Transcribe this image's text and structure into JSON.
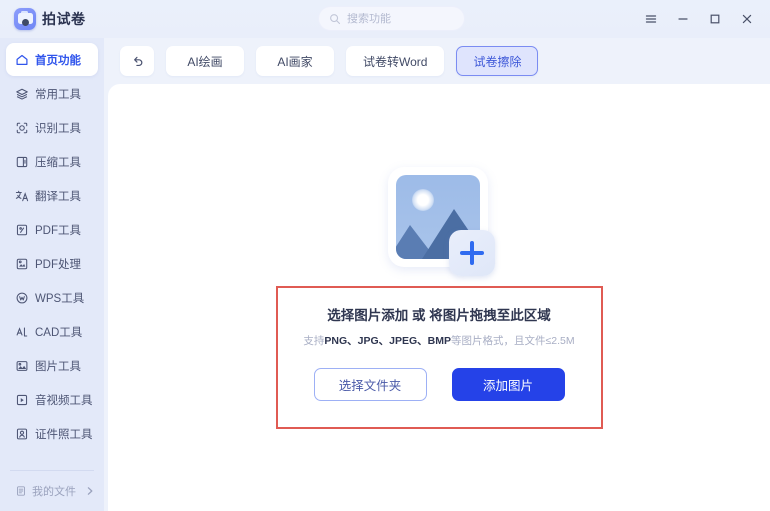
{
  "app": {
    "brand_name": "拍试卷",
    "logo_icon": "camera-app-icon"
  },
  "search": {
    "placeholder": "搜索功能",
    "value": "",
    "icon": "search-icon"
  },
  "window_controls": [
    {
      "name": "menu-button",
      "icon": "hamburger-menu-icon"
    },
    {
      "name": "minimize-button",
      "icon": "minimize-icon"
    },
    {
      "name": "maximize-button",
      "icon": "maximize-square-icon"
    },
    {
      "name": "close-button",
      "icon": "close-x-icon"
    }
  ],
  "sidebar": {
    "items": [
      {
        "label": "首页功能",
        "icon": "home-icon",
        "active": true
      },
      {
        "label": "常用工具",
        "icon": "layers-icon",
        "active": false
      },
      {
        "label": "识别工具",
        "icon": "scan-target-icon",
        "active": false
      },
      {
        "label": "压缩工具",
        "icon": "compress-icon",
        "active": false
      },
      {
        "label": "翻译工具",
        "icon": "translate-icon",
        "active": false
      },
      {
        "label": "PDF工具",
        "icon": "pdf-file-icon",
        "active": false
      },
      {
        "label": "PDF处理",
        "icon": "pdf-process-icon",
        "active": false
      },
      {
        "label": "WPS工具",
        "icon": "wps-circle-icon",
        "active": false
      },
      {
        "label": "CAD工具",
        "icon": "cad-ruler-icon",
        "active": false
      },
      {
        "label": "图片工具",
        "icon": "image-icon",
        "active": false
      },
      {
        "label": "音视频工具",
        "icon": "media-play-icon",
        "active": false
      },
      {
        "label": "证件照工具",
        "icon": "id-photo-icon",
        "active": false
      }
    ],
    "footer": {
      "label": "我的文件",
      "icon": "file-doc-icon",
      "chevron": "chevron-right-icon"
    }
  },
  "toolbar": {
    "back_icon": "undo-arrow-icon",
    "tabs": [
      {
        "label": "AI绘画",
        "active": false
      },
      {
        "label": "AI画家",
        "active": false
      },
      {
        "label": "试卷转Word",
        "active": false
      },
      {
        "label": "试卷擦除",
        "active": true
      }
    ]
  },
  "dropzone": {
    "placeholder_icon": "image-placeholder-add-icon",
    "title": "选择图片添加 或 将图片拖拽至此区域",
    "hint_prefix": "支持",
    "hint_formats": "PNG、JPG、JPEG、BMP",
    "hint_suffix": "等图片格式，且文件≤2.5M",
    "choose_folder_label": "选择文件夹",
    "add_image_label": "添加图片",
    "highlight_color": "#e05b53"
  },
  "colors": {
    "accent": "#2542e8",
    "active_nav": "#3055ec",
    "sidebar_bg": "#e3e9f9",
    "app_bg": "#eef2fb"
  }
}
